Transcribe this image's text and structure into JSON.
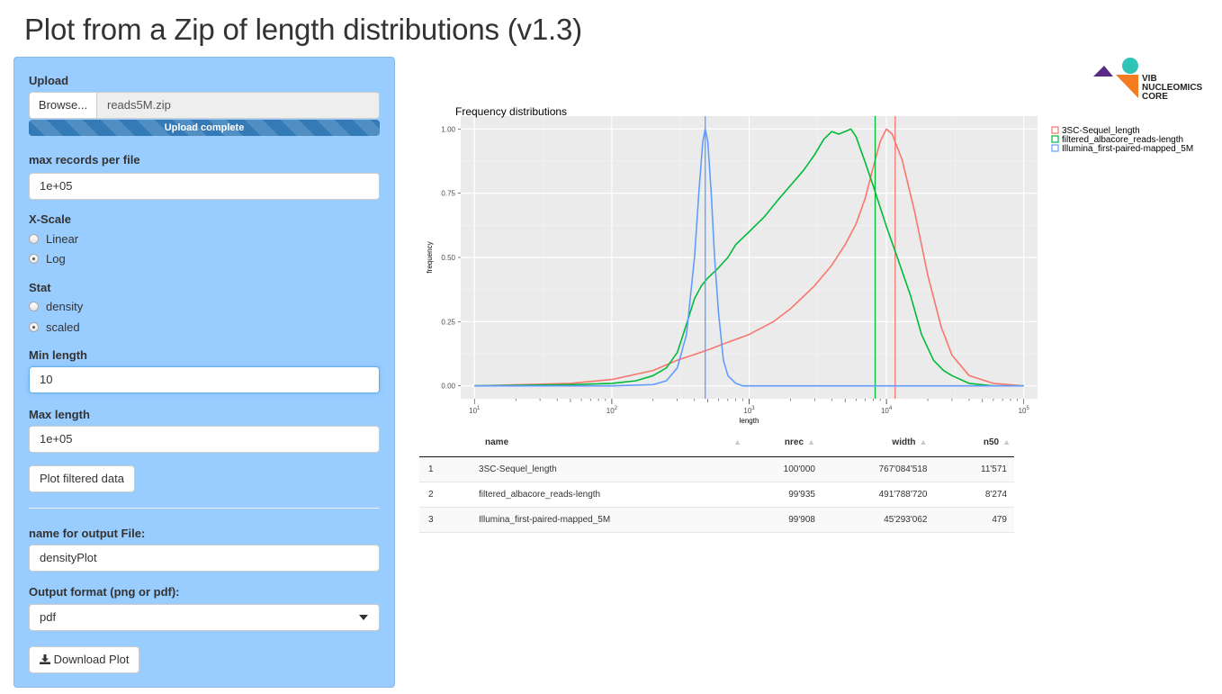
{
  "title": "Plot from a Zip of length distributions (v1.3)",
  "sidebar": {
    "upload": {
      "label": "Upload",
      "browse_label": "Browse...",
      "filename": "reads5M.zip",
      "progress_label": "Upload complete"
    },
    "max_records": {
      "label": "max records per file",
      "value": "1e+05"
    },
    "xscale": {
      "label": "X-Scale",
      "options": [
        "Linear",
        "Log"
      ],
      "selected": "Log"
    },
    "stat": {
      "label": "Stat",
      "options": [
        "density",
        "scaled"
      ],
      "selected": "scaled"
    },
    "min_length": {
      "label": "Min length",
      "value": "10"
    },
    "max_length": {
      "label": "Max length",
      "value": "1e+05"
    },
    "plot_button": "Plot filtered data",
    "output_name": {
      "label": "name for output File:",
      "value": "densityPlot"
    },
    "output_format": {
      "label": "Output format (png or pdf):",
      "value": "pdf"
    },
    "download_button": "Download Plot"
  },
  "logo": {
    "line1": "VIB",
    "line2": "NUCLEOMICS",
    "line3": "CORE",
    "colors": [
      "#5b2a86",
      "#2ec4b6",
      "#f47c20"
    ]
  },
  "chart_data": {
    "type": "line",
    "title": "Frequency distributions",
    "xlabel": "length",
    "ylabel": "frequency",
    "xscale": "log10",
    "xlim": [
      10,
      100000
    ],
    "ylim": [
      0,
      1
    ],
    "x_ticks": [
      "10^1",
      "10^2",
      "10^3",
      "10^4",
      "10^5"
    ],
    "y_ticks": [
      "0.00",
      "0.25",
      "0.50",
      "0.75",
      "1.00"
    ],
    "legend_position": "right",
    "grid": true,
    "series": [
      {
        "name": "3SC-Sequel_length",
        "color": "#f8766d",
        "vline": 11571,
        "points": [
          [
            10,
            0
          ],
          [
            50,
            0.01
          ],
          [
            100,
            0.025
          ],
          [
            200,
            0.06
          ],
          [
            300,
            0.1
          ],
          [
            500,
            0.14
          ],
          [
            700,
            0.17
          ],
          [
            1000,
            0.2
          ],
          [
            1500,
            0.25
          ],
          [
            2000,
            0.3
          ],
          [
            3000,
            0.39
          ],
          [
            4000,
            0.47
          ],
          [
            5000,
            0.55
          ],
          [
            6000,
            0.63
          ],
          [
            7000,
            0.73
          ],
          [
            8000,
            0.85
          ],
          [
            9000,
            0.95
          ],
          [
            10000,
            1.0
          ],
          [
            11000,
            0.98
          ],
          [
            13000,
            0.88
          ],
          [
            16000,
            0.68
          ],
          [
            20000,
            0.43
          ],
          [
            25000,
            0.23
          ],
          [
            30000,
            0.12
          ],
          [
            40000,
            0.04
          ],
          [
            60000,
            0.01
          ],
          [
            100000,
            0
          ]
        ]
      },
      {
        "name": "filtered_albacore_reads-length",
        "color": "#00ba38",
        "vline": 8274,
        "points": [
          [
            10,
            0
          ],
          [
            50,
            0.005
          ],
          [
            100,
            0.01
          ],
          [
            150,
            0.02
          ],
          [
            200,
            0.04
          ],
          [
            250,
            0.07
          ],
          [
            300,
            0.13
          ],
          [
            350,
            0.24
          ],
          [
            400,
            0.34
          ],
          [
            450,
            0.39
          ],
          [
            500,
            0.42
          ],
          [
            600,
            0.46
          ],
          [
            700,
            0.5
          ],
          [
            800,
            0.55
          ],
          [
            1000,
            0.6
          ],
          [
            1300,
            0.66
          ],
          [
            1600,
            0.72
          ],
          [
            2000,
            0.78
          ],
          [
            2500,
            0.84
          ],
          [
            3000,
            0.9
          ],
          [
            3500,
            0.96
          ],
          [
            4000,
            0.99
          ],
          [
            4500,
            0.98
          ],
          [
            5000,
            0.99
          ],
          [
            5500,
            1.0
          ],
          [
            6000,
            0.97
          ],
          [
            7000,
            0.87
          ],
          [
            8000,
            0.78
          ],
          [
            10000,
            0.62
          ],
          [
            12000,
            0.5
          ],
          [
            15000,
            0.35
          ],
          [
            18000,
            0.2
          ],
          [
            22000,
            0.1
          ],
          [
            26000,
            0.06
          ],
          [
            30000,
            0.04
          ],
          [
            40000,
            0.01
          ],
          [
            60000,
            0
          ],
          [
            100000,
            0
          ]
        ]
      },
      {
        "name": "Illumina_first-paired-mapped_5M",
        "color": "#619cff",
        "vline": 479,
        "points": [
          [
            10,
            0
          ],
          [
            100,
            0
          ],
          [
            200,
            0.005
          ],
          [
            250,
            0.02
          ],
          [
            300,
            0.07
          ],
          [
            350,
            0.2
          ],
          [
            400,
            0.5
          ],
          [
            430,
            0.75
          ],
          [
            460,
            0.95
          ],
          [
            479,
            1.0
          ],
          [
            500,
            0.95
          ],
          [
            530,
            0.75
          ],
          [
            560,
            0.5
          ],
          [
            600,
            0.28
          ],
          [
            650,
            0.1
          ],
          [
            700,
            0.04
          ],
          [
            800,
            0.01
          ],
          [
            900,
            0
          ],
          [
            1000,
            0
          ],
          [
            100000,
            0
          ]
        ]
      }
    ]
  },
  "table": {
    "columns": [
      "",
      "name",
      "nrec",
      "width",
      "n50"
    ],
    "rows": [
      [
        "1",
        "3SC-Sequel_length",
        "100'000",
        "767'084'518",
        "11'571"
      ],
      [
        "2",
        "filtered_albacore_reads-length",
        "99'935",
        "491'788'720",
        "8'274"
      ],
      [
        "3",
        "Illumina_first-paired-mapped_5M",
        "99'908",
        "45'293'062",
        "479"
      ]
    ]
  }
}
